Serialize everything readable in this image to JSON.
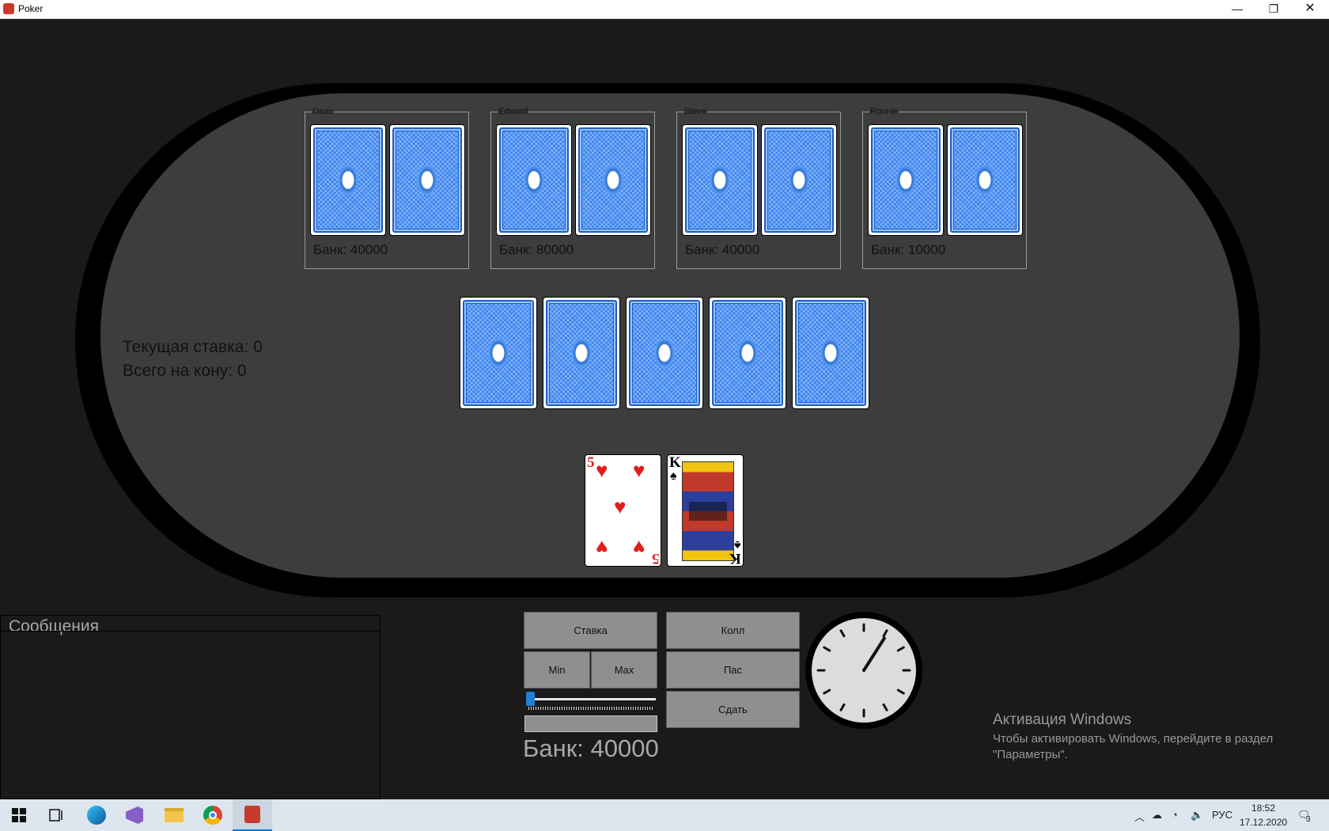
{
  "window": {
    "title": "Poker",
    "minimize": "—",
    "maximize": "❐",
    "close": "✕"
  },
  "players": [
    {
      "name": "Dean",
      "bank": "Банк: 40000"
    },
    {
      "name": "Edward",
      "bank": "Банк: 80000"
    },
    {
      "name": "Steve",
      "bank": "Банк: 40000"
    },
    {
      "name": "Ronnie",
      "bank": "Банк: 10000"
    }
  ],
  "community_cards": [
    "back",
    "back",
    "back",
    "back",
    "back"
  ],
  "info": {
    "current_bet": "Текущая ставка: 0",
    "total_pot": "Всего на кону: 0"
  },
  "hand": [
    {
      "rank": "5",
      "suit": "♥",
      "color": "#e21d1d"
    },
    {
      "rank": "K",
      "suit": "♠",
      "color": "#000000"
    }
  ],
  "messages": {
    "title": "Сообщения"
  },
  "controls": {
    "bet": "Ставка",
    "min": "Min",
    "max": "Max",
    "call": "Колл",
    "check": "Пас",
    "fold": "Сдать",
    "slider_value": 0,
    "bank": "Банк: 40000"
  },
  "clock": {
    "hour": 1,
    "minute": 5
  },
  "activation": {
    "title": "Активация Windows",
    "line1": "Чтобы активировать Windows, перейдите в раздел",
    "line2": "\"Параметры\"."
  },
  "taskbar": {
    "lang": "РУС",
    "time": "18:52",
    "date": "17.12.2020",
    "notifications": "3"
  },
  "colors": {
    "felt": "#3d3d3d",
    "rim": "#000000",
    "card_back": "#3d86f0",
    "accent": "#0078d7"
  }
}
